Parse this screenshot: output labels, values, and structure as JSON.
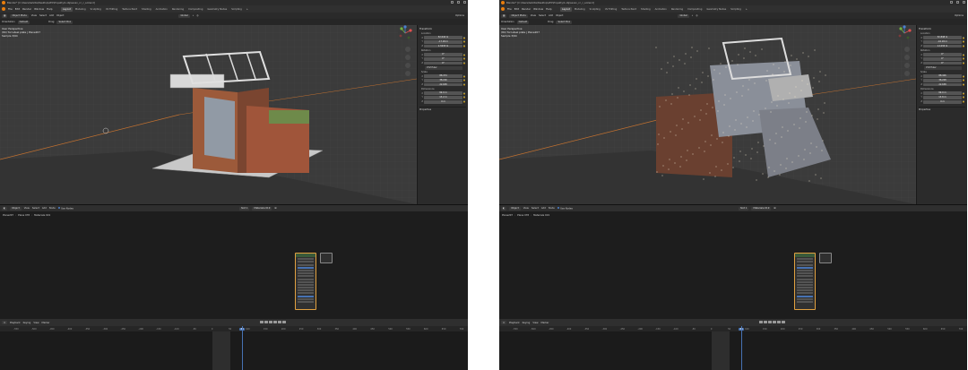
{
  "colors": {
    "accent": "#4772b3",
    "logo": "#e87d0d",
    "node_border": "#e0a040",
    "background": "#1d1d1d"
  },
  "icons": {
    "blender_logo": "blender-logo",
    "gizmo": "navigation-gizmo",
    "lock": "🔒",
    "mode": "mode-icon"
  },
  "left": {
    "window_title": "Blender* [C:\\Users\\GeVilla\\Desktop\\AEC\\Projekty\\1.obj\\seven_cc_c_a.blend]",
    "menu": [
      "File",
      "Edit",
      "Render",
      "Window",
      "Help"
    ],
    "workspaces": [
      "Layout",
      "Modeling",
      "Sculpting",
      "UV Editing",
      "Texture Paint",
      "Shading",
      "Animation",
      "Rendering",
      "Compositing",
      "Geometry Nodes",
      "Scripting",
      "+"
    ],
    "active_workspace": "Layout",
    "viewport_header": {
      "mode": "Object Mode",
      "items": [
        "View",
        "Select",
        "Add",
        "Object"
      ],
      "transform": "Global",
      "options": "Options"
    },
    "viewport_header2": {
      "orientation": "Orientation",
      "orientation_value": "Default",
      "drag": "Drag",
      "drag_value": "Select Box"
    },
    "viewport_info": [
      "User Perspective",
      "(84) Turl.steel plate | Plane207",
      "Sample 3/64"
    ],
    "npanel": {
      "header": "Transform",
      "location_label": "Location",
      "location": [
        [
          "X",
          "52.044 m"
        ],
        [
          "Y",
          "-17.18 m"
        ],
        [
          "Z",
          "1.3233 m"
        ]
      ],
      "rotation_label": "Rotation",
      "rotation": [
        [
          "X",
          "0°"
        ],
        [
          "Y",
          "0°"
        ],
        [
          "Z",
          "0°"
        ]
      ],
      "rotation_mode": "XYZ Euler",
      "scale_label": "Scale",
      "scale": [
        [
          "X",
          "88.474"
        ],
        [
          "Y",
          "38.216"
        ],
        [
          "Z",
          "22.638"
        ]
      ],
      "dimensions_label": "Dimensions",
      "dimensions": [
        [
          "X",
          "99.0 m"
        ],
        [
          "Y",
          "13.2 m"
        ],
        [
          "Z",
          "0 m"
        ]
      ],
      "footer": "Properties"
    },
    "node_header": {
      "type": "Object",
      "items": [
        "View",
        "Select",
        "Add",
        "Node"
      ],
      "use_nodes": "Use Nodes",
      "slot": "Slot 1",
      "material": "Materiale 019"
    },
    "breadcrumbs": [
      "Plane207",
      "Plane 078",
      "Materiale 019"
    ],
    "timeline_header": {
      "items": [
        "Playback",
        "Keying",
        "View",
        "Marker"
      ]
    },
    "ruler": [
      "-550",
      "-500",
      "-450",
      "-400",
      "-350",
      "-300",
      "-250",
      "-200",
      "-150",
      "-100",
      "-50",
      "0",
      "50",
      "100",
      "150",
      "200",
      "250",
      "300",
      "350",
      "400",
      "450",
      "500",
      "550",
      "600",
      "650",
      "700"
    ],
    "current_frame": "84"
  },
  "right": {
    "window_title": "Blender* [C:\\Users\\GeVilla\\Desktop\\AEC\\Projekty\\1.obj\\seven_cc_c_a.blend]",
    "menu": [
      "File",
      "Edit",
      "Render",
      "Window",
      "Help"
    ],
    "workspaces": [
      "Layout",
      "Modeling",
      "Sculpting",
      "UV Editing",
      "Texture Paint",
      "Shading",
      "Animation",
      "Rendering",
      "Compositing",
      "Geometry Nodes",
      "Scripting",
      "+"
    ],
    "active_workspace": "Layout",
    "viewport_header": {
      "mode": "Object Mode",
      "items": [
        "View",
        "Select",
        "Add",
        "Object"
      ],
      "transform": "Global",
      "options": "Options"
    },
    "viewport_header2": {
      "orientation": "Orientation",
      "orientation_value": "Default",
      "drag": "Drag",
      "drag_value": "Select Box"
    },
    "viewport_info": [
      "User Perspective",
      "(84) Turl.steel plate | Plane207",
      "Sample 3/64"
    ],
    "npanel": {
      "header": "Transform",
      "location_label": "Location",
      "location": [
        [
          "X",
          "52.848 m"
        ],
        [
          "Y",
          "-16.18 m"
        ],
        [
          "Z",
          "1.1234 m"
        ]
      ],
      "rotation_label": "Rotation",
      "rotation": [
        [
          "X",
          "0°"
        ],
        [
          "Y",
          "0°"
        ],
        [
          "Z",
          "0°"
        ]
      ],
      "rotation_mode": "XYZ Euler",
      "scale_label": "Scale",
      "scale": [
        [
          "X",
          "88.426"
        ],
        [
          "Y",
          "36.228"
        ],
        [
          "Z",
          "22.638"
        ]
      ],
      "dimensions_label": "Dimensions",
      "dimensions": [
        [
          "X",
          "99.0 m"
        ],
        [
          "Y",
          "13.8 m"
        ],
        [
          "Z",
          "0 m"
        ]
      ],
      "footer": "Properties"
    },
    "node_header": {
      "type": "Object",
      "items": [
        "View",
        "Select",
        "Add",
        "Node"
      ],
      "use_nodes": "Use Nodes",
      "slot": "Slot 1",
      "material": "Materiale 019"
    },
    "breadcrumbs": [
      "Plane207",
      "Plane 078",
      "Materiale 019"
    ],
    "timeline_header": {
      "items": [
        "Playback",
        "Keying",
        "View",
        "Marker"
      ]
    },
    "ruler": [
      "-550",
      "-500",
      "-450",
      "-400",
      "-350",
      "-300",
      "-250",
      "-200",
      "-150",
      "-100",
      "-50",
      "0",
      "50",
      "100",
      "150",
      "200",
      "250",
      "300",
      "350",
      "400",
      "450",
      "500",
      "550",
      "600",
      "650",
      "700"
    ],
    "current_frame": "84"
  }
}
